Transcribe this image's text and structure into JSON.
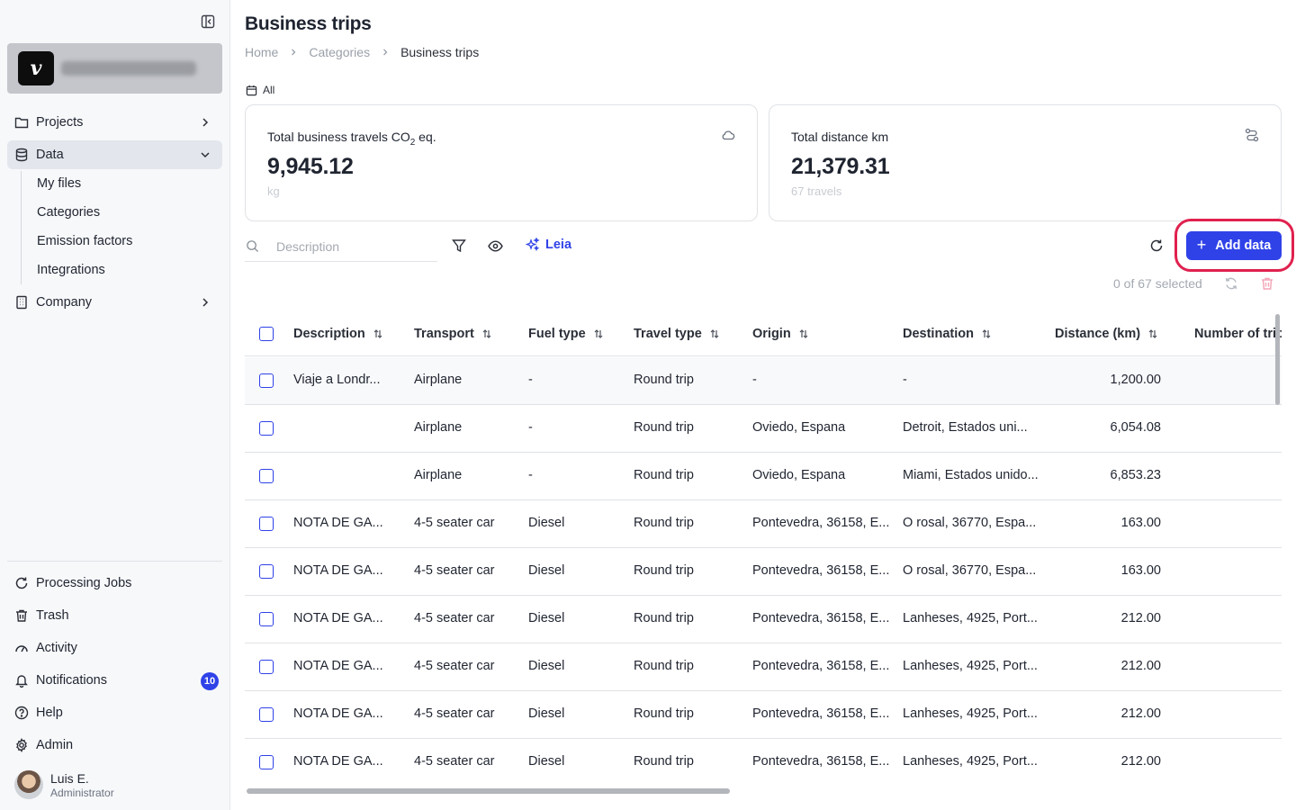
{
  "sidebar": {
    "org_logo_letter": "v",
    "nav": {
      "projects": "Projects",
      "data": "Data",
      "company": "Company"
    },
    "data_children": [
      "My files",
      "Categories",
      "Emission factors",
      "Integrations"
    ],
    "bottom": {
      "processing_jobs": "Processing Jobs",
      "trash": "Trash",
      "activity": "Activity",
      "notifications": "Notifications",
      "notifications_count": "10",
      "help": "Help",
      "admin": "Admin"
    },
    "user": {
      "name": "Luis E.",
      "role": "Administrator"
    }
  },
  "header": {
    "title": "Business trips",
    "breadcrumb": [
      "Home",
      "Categories",
      "Business trips"
    ],
    "period": "All"
  },
  "kpis": [
    {
      "title": "Total business travels CO",
      "title_sub": "2",
      "title_suffix": " eq.",
      "value": "9,945.12",
      "unit": "kg",
      "icon": "cloud-icon"
    },
    {
      "title": "Total distance km",
      "value": "21,379.31",
      "unit": "67 travels",
      "icon": "route-icon"
    }
  ],
  "toolbar": {
    "search_placeholder": "Description",
    "leia_label": "Leia",
    "add_label": "Add data",
    "selected_text": "0 of 67 selected"
  },
  "colors": {
    "accent": "#2f42e8",
    "highlight": "#e0214e",
    "danger": "#f3a3b5"
  },
  "table": {
    "columns": [
      "Description",
      "Transport",
      "Fuel type",
      "Travel type",
      "Origin",
      "Destination",
      "Distance (km)",
      "Number of trip"
    ],
    "rows": [
      [
        "Viaje a Londr...",
        "Airplane",
        "-",
        "Round trip",
        "-",
        "-",
        "1,200.00"
      ],
      [
        "",
        "Airplane",
        "-",
        "Round trip",
        "Oviedo, Espana",
        "Detroit, Estados uni...",
        "6,054.08"
      ],
      [
        "",
        "Airplane",
        "-",
        "Round trip",
        "Oviedo, Espana",
        "Miami, Estados unido...",
        "6,853.23"
      ],
      [
        "NOTA DE GA...",
        "4-5 seater car",
        "Diesel",
        "Round trip",
        "Pontevedra, 36158, E...",
        "O rosal, 36770, Espa...",
        "163.00"
      ],
      [
        "NOTA DE GA...",
        "4-5 seater car",
        "Diesel",
        "Round trip",
        "Pontevedra, 36158, E...",
        "O rosal, 36770, Espa...",
        "163.00"
      ],
      [
        "NOTA DE GA...",
        "4-5 seater car",
        "Diesel",
        "Round trip",
        "Pontevedra, 36158, E...",
        "Lanheses, 4925, Port...",
        "212.00"
      ],
      [
        "NOTA DE GA...",
        "4-5 seater car",
        "Diesel",
        "Round trip",
        "Pontevedra, 36158, E...",
        "Lanheses, 4925, Port...",
        "212.00"
      ],
      [
        "NOTA DE GA...",
        "4-5 seater car",
        "Diesel",
        "Round trip",
        "Pontevedra, 36158, E...",
        "Lanheses, 4925, Port...",
        "212.00"
      ],
      [
        "NOTA DE GA...",
        "4-5 seater car",
        "Diesel",
        "Round trip",
        "Pontevedra, 36158, E...",
        "Lanheses, 4925, Port...",
        "212.00"
      ]
    ]
  }
}
